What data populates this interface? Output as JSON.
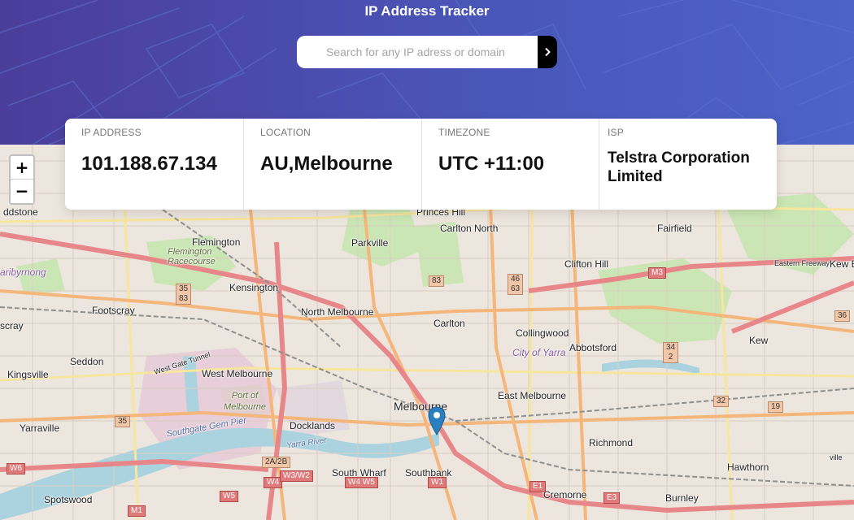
{
  "header": {
    "title": "IP Address Tracker",
    "gradient": [
      "#4b3d9a",
      "#4c63c8"
    ]
  },
  "search": {
    "placeholder": "Search for any IP adress or domain",
    "value": "",
    "button_icon": "chevron-right-icon"
  },
  "info": {
    "ip": {
      "label": "IP ADDRESS",
      "value": "101.188.67.134"
    },
    "location": {
      "label": "LOCATION",
      "value": "AU,Melbourne"
    },
    "timezone": {
      "label": "TIMEZONE",
      "value": "UTC +11:00"
    },
    "isp": {
      "label": "ISP",
      "value": "Telstra Corporation Limited"
    }
  },
  "map": {
    "zoom_in": "+",
    "zoom_out": "−",
    "marker_icon": "location-pin-icon",
    "places": {
      "ddstone": "ddstone",
      "flemington": "Flemington",
      "flemington_racecourse": "Flemington Racecourse",
      "kensington": "Kensington",
      "footscray": "Footscray",
      "seddon": "Seddon",
      "kingsville": "Kingsville",
      "yarraville": "Yarraville",
      "spotswood": "Spotswood",
      "west_melbourne": "West Melbourne",
      "port_of_melbourne": "Port of Melbourne",
      "docklands": "Docklands",
      "north_melbourne": "North Melbourne",
      "parkville": "Parkville",
      "princes_hill": "Princes Hill",
      "carlton_north": "Carlton North",
      "carlton": "Carlton",
      "melbourne": "Melbourne",
      "collingwood": "Collingwood",
      "city_of_yarra": "City of Yarra",
      "abbotsford": "Abbotsford",
      "clifton_hill": "Clifton Hill",
      "fairfield": "Fairfield",
      "kew": "Kew",
      "east_melbourne": "East Melbourne",
      "richmond": "Richmond",
      "hawthorn": "Hawthorn",
      "cremorne": "Cremorne",
      "burnley": "Burnley",
      "south_wharf": "South Wharf",
      "southbank": "Southbank",
      "eastern_freeway": "Eastern Freeway",
      "west_gate_tunnel": "West Gate Tunnel",
      "southgate_gem_pier": "Southgate Gem Pier",
      "yarra_river": "Yarra River",
      "maribyrnong": "aribyrnong",
      "scray": "scray",
      "kew_e": "Kew E",
      "ville": "ville"
    },
    "shields": {
      "s35_83": "35\n83",
      "s83": "83",
      "s46_63": "46\n63",
      "m3": "M3",
      "s36": "36",
      "s34_2": "34\n2",
      "s32": "32",
      "s19": "19",
      "s35": "35",
      "m1": "M1",
      "w6": "W6",
      "w5": "W5",
      "w4": "W4",
      "w3w2": "W3/W2",
      "w4w5": "W4 W5",
      "w1": "W1",
      "e3": "E3",
      "e1": "E1",
      "s2a2b": "2A/2B"
    }
  }
}
